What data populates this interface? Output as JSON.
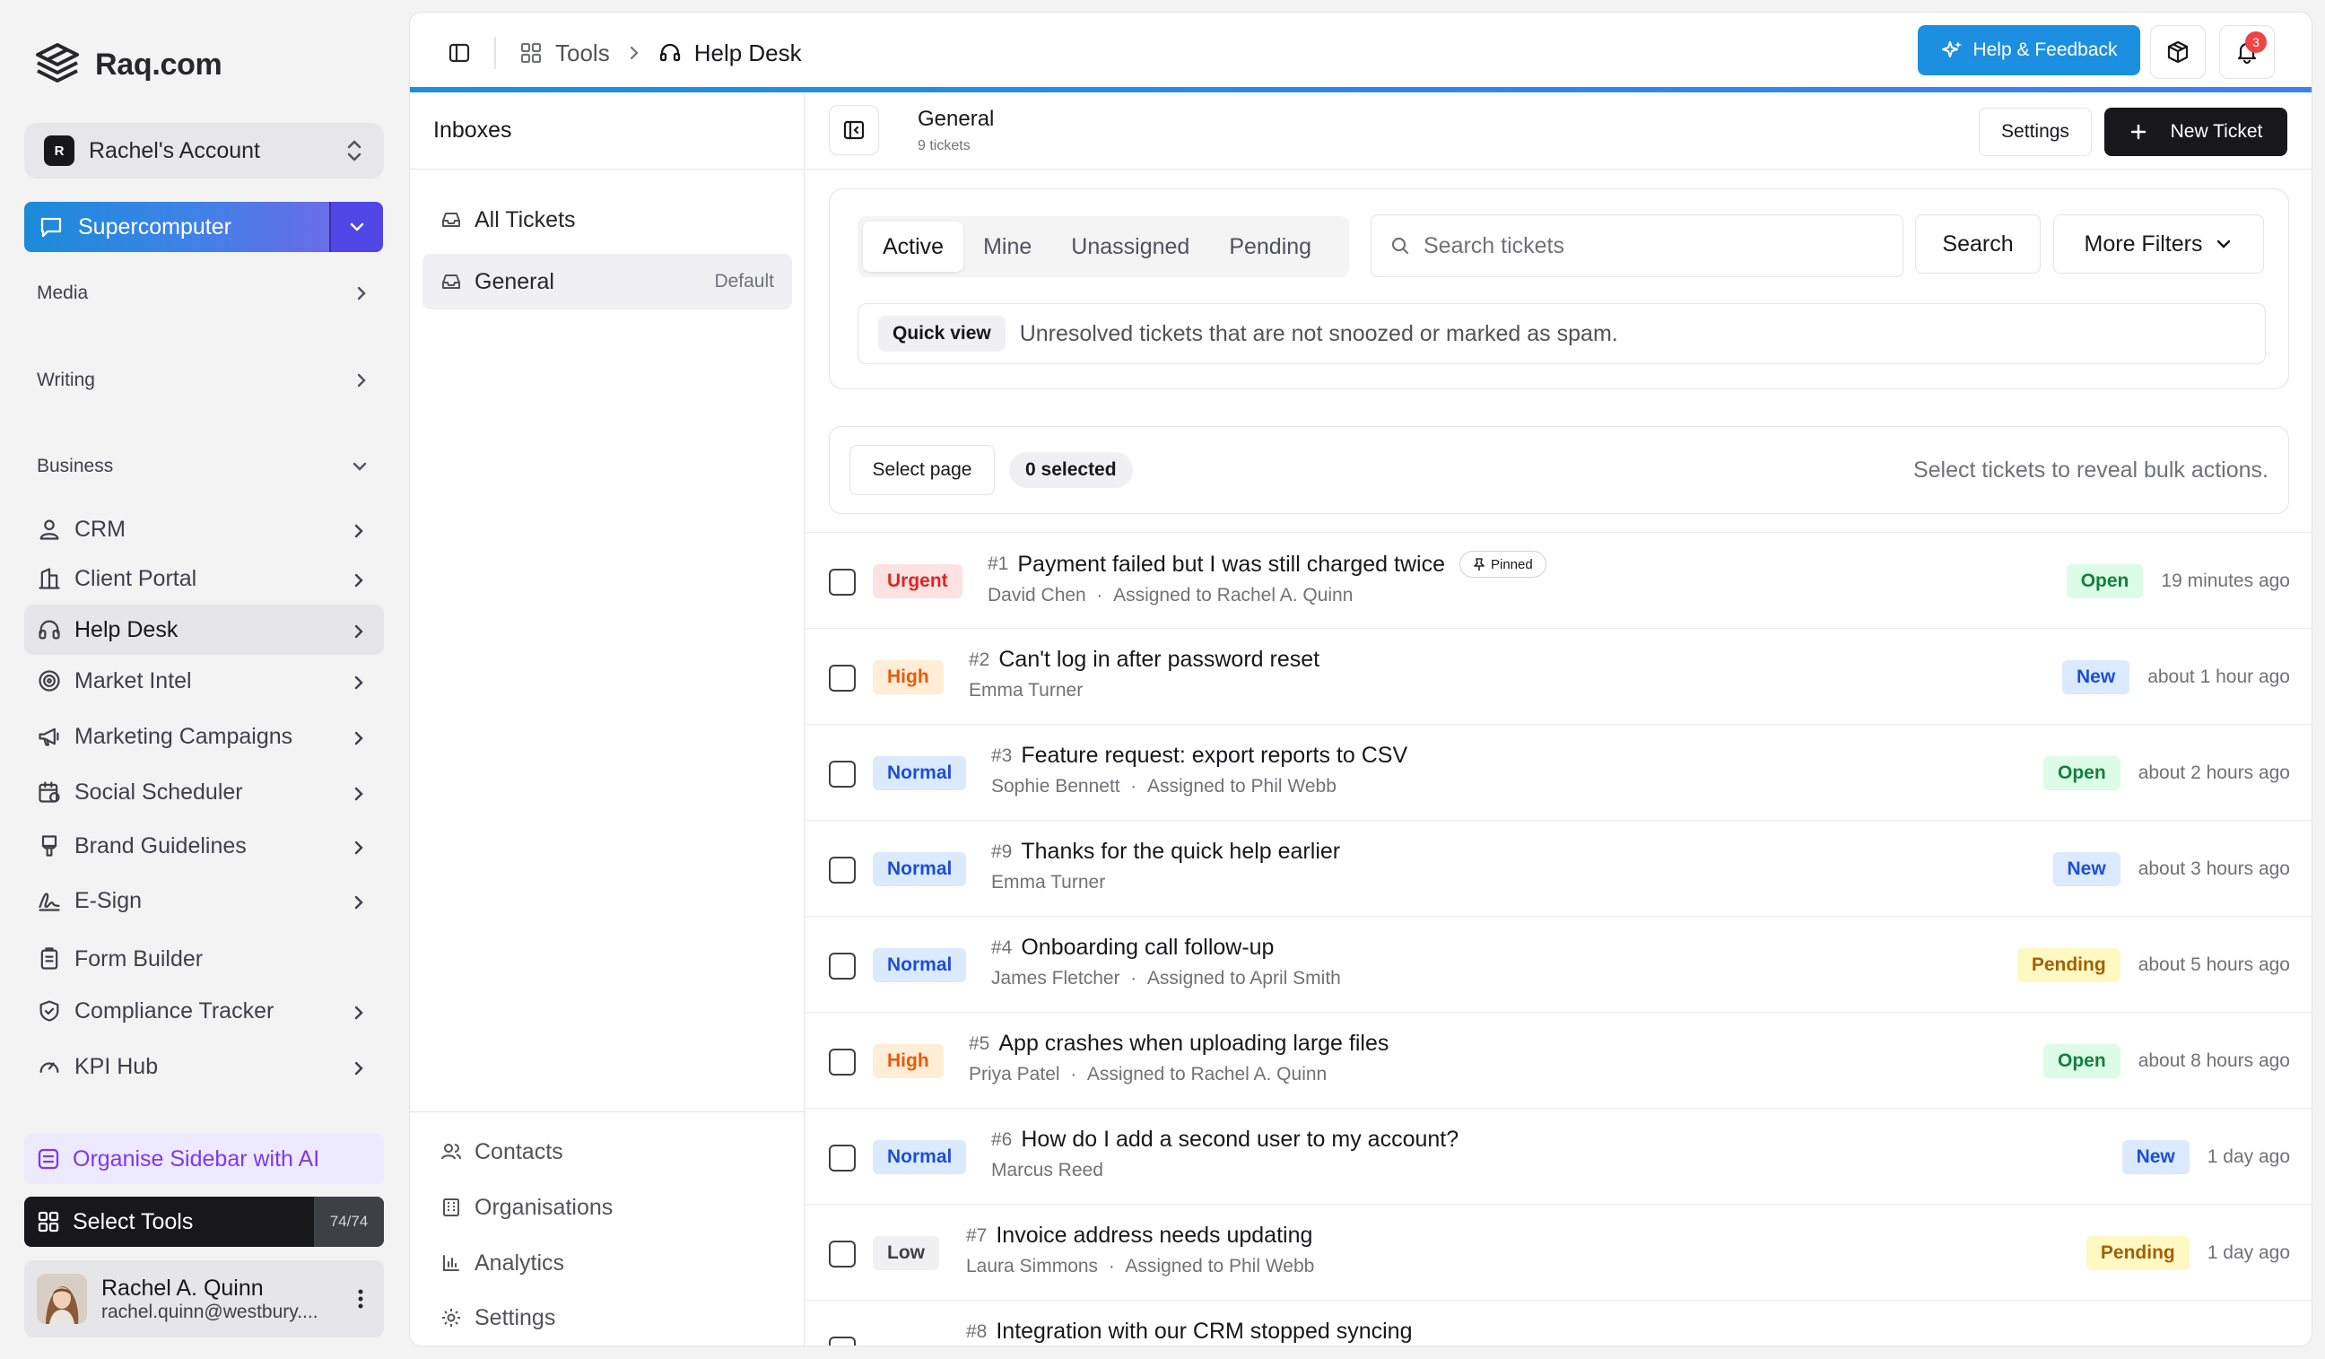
{
  "brand": {
    "name": "Raq.com"
  },
  "account": {
    "initial": "R",
    "name": "Rachel's Account"
  },
  "supercomputer": {
    "label": "Supercomputer"
  },
  "sections": {
    "media": "Media",
    "writing": "Writing",
    "business": "Business"
  },
  "nav": [
    {
      "label": "CRM",
      "icon": "crm-icon"
    },
    {
      "label": "Client Portal",
      "icon": "client-portal-icon"
    },
    {
      "label": "Help Desk",
      "icon": "headset-icon"
    },
    {
      "label": "Market Intel",
      "icon": "target-icon"
    },
    {
      "label": "Marketing Campaigns",
      "icon": "megaphone-icon"
    },
    {
      "label": "Social Scheduler",
      "icon": "calendar-clock-icon"
    },
    {
      "label": "Brand Guidelines",
      "icon": "brush-icon"
    },
    {
      "label": "E-Sign",
      "icon": "signature-icon"
    },
    {
      "label": "Form Builder",
      "icon": "clipboard-icon"
    },
    {
      "label": "Compliance Tracker",
      "icon": "shield-check-icon"
    },
    {
      "label": "KPI Hub",
      "icon": "gauge-icon"
    }
  ],
  "organise": {
    "label": "Organise Sidebar with AI"
  },
  "select_tools": {
    "label": "Select Tools",
    "count": "74/74"
  },
  "user": {
    "name": "Rachel A. Quinn",
    "email": "rachel.quinn@westbury...."
  },
  "topbar": {
    "crumb_tools": "Tools",
    "crumb_current": "Help Desk",
    "help_label": "Help & Feedback",
    "notif_count": "3"
  },
  "inboxes": {
    "title": "Inboxes",
    "all": "All Tickets",
    "general": "General",
    "default_tag": "Default",
    "footer": [
      "Contacts",
      "Organisations",
      "Analytics",
      "Settings"
    ]
  },
  "content": {
    "inbox_title": "General",
    "inbox_count": "9 tickets",
    "settings": "Settings",
    "new_ticket": "New Ticket",
    "tabs": [
      "Active",
      "Mine",
      "Unassigned",
      "Pending"
    ],
    "search_placeholder": "Search tickets",
    "search_button": "Search",
    "more_filters": "More Filters",
    "quick_view_tag": "Quick view",
    "quick_view_text": "Unresolved tickets that are not snoozed or marked as spam.",
    "select_page": "Select page",
    "selected": "0 selected",
    "bulk_hint": "Select tickets to reveal bulk actions."
  },
  "tickets": [
    {
      "priority": "Urgent",
      "pclass": "p-urgent",
      "num": "#1",
      "title": "Payment failed but I was still charged twice",
      "pinned": "Pinned",
      "customer": "David Chen",
      "assigned": "Assigned to Rachel A. Quinn",
      "status": "Open",
      "sclass": "s-open",
      "time": "19 minutes ago"
    },
    {
      "priority": "High",
      "pclass": "p-high",
      "num": "#2",
      "title": "Can't log in after password reset",
      "pinned": "",
      "customer": "Emma Turner",
      "assigned": "",
      "status": "New",
      "sclass": "s-new",
      "time": "about 1 hour ago"
    },
    {
      "priority": "Normal",
      "pclass": "p-normal",
      "num": "#3",
      "title": "Feature request: export reports to CSV",
      "pinned": "",
      "customer": "Sophie Bennett",
      "assigned": "Assigned to Phil Webb",
      "status": "Open",
      "sclass": "s-open",
      "time": "about 2 hours ago"
    },
    {
      "priority": "Normal",
      "pclass": "p-normal",
      "num": "#9",
      "title": "Thanks for the quick help earlier",
      "pinned": "",
      "customer": "Emma Turner",
      "assigned": "",
      "status": "New",
      "sclass": "s-new",
      "time": "about 3 hours ago"
    },
    {
      "priority": "Normal",
      "pclass": "p-normal",
      "num": "#4",
      "title": "Onboarding call follow-up",
      "pinned": "",
      "customer": "James Fletcher",
      "assigned": "Assigned to April Smith",
      "status": "Pending",
      "sclass": "s-pending",
      "time": "about 5 hours ago"
    },
    {
      "priority": "High",
      "pclass": "p-high",
      "num": "#5",
      "title": "App crashes when uploading large files",
      "pinned": "",
      "customer": "Priya Patel",
      "assigned": "Assigned to Rachel A. Quinn",
      "status": "Open",
      "sclass": "s-open",
      "time": "about 8 hours ago"
    },
    {
      "priority": "Normal",
      "pclass": "p-normal",
      "num": "#6",
      "title": "How do I add a second user to my account?",
      "pinned": "",
      "customer": "Marcus Reed",
      "assigned": "",
      "status": "New",
      "sclass": "s-new",
      "time": "1 day ago"
    },
    {
      "priority": "Low",
      "pclass": "p-low",
      "num": "#7",
      "title": "Invoice address needs updating",
      "pinned": "",
      "customer": "Laura Simmons",
      "assigned": "Assigned to Phil Webb",
      "status": "Pending",
      "sclass": "s-pending",
      "time": "1 day ago"
    },
    {
      "priority": "",
      "pclass": "p-high",
      "num": "#8",
      "title": "Integration with our CRM stopped syncing",
      "pinned": "",
      "customer": "",
      "assigned": "",
      "status": "",
      "sclass": "s-pending",
      "time": ""
    }
  ]
}
